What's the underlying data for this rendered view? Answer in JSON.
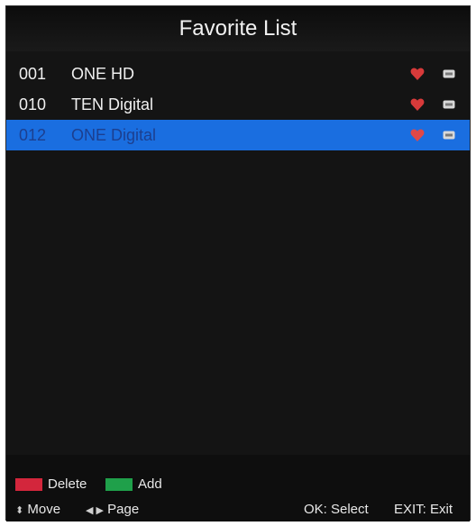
{
  "title": "Favorite List",
  "channels": [
    {
      "number": "001",
      "name": "ONE HD",
      "selected": false
    },
    {
      "number": "010",
      "name": "TEN Digital",
      "selected": false
    },
    {
      "number": "012",
      "name": "ONE Digital",
      "selected": true
    }
  ],
  "legend": {
    "delete_label": "Delete",
    "delete_color": "#d3263c",
    "add_label": "Add",
    "add_color": "#1fa04a"
  },
  "help": {
    "move_label": "Move",
    "page_label": "Page",
    "ok_label": "OK: Select",
    "exit_label": "EXIT: Exit"
  },
  "colors": {
    "highlight": "#1a6ee0",
    "favorite_icon": "#d83a3a",
    "lock_icon": "#d8d8d8"
  }
}
